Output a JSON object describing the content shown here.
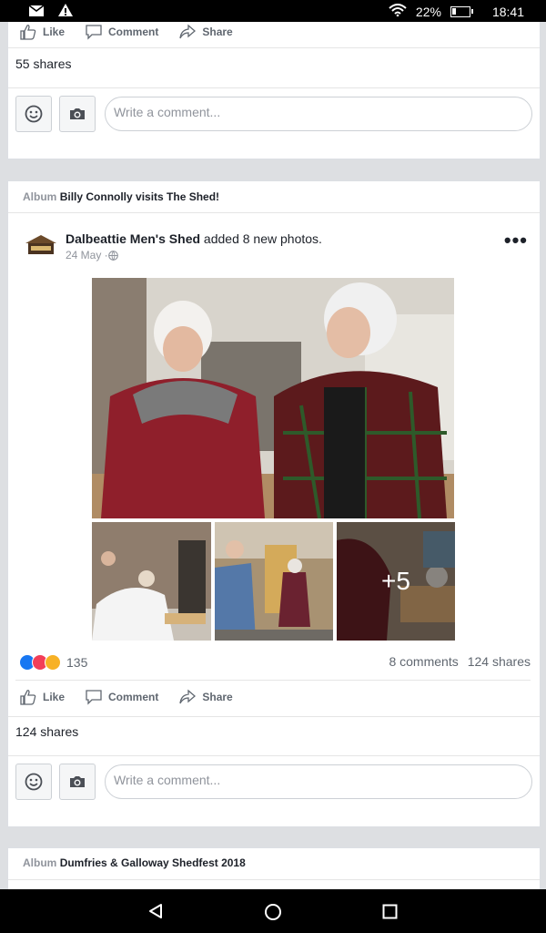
{
  "status_bar": {
    "battery": "22%",
    "time": "18:41",
    "battery_level": 0.22
  },
  "post1": {
    "actions": {
      "like": "Like",
      "comment": "Comment",
      "share": "Share"
    },
    "shares": "55 shares",
    "comment_placeholder": "Write a comment..."
  },
  "post2": {
    "album_label": "Album",
    "album_name": "Billy Connolly visits The Shed!",
    "author": "Dalbeattie Men's Shed",
    "action_text": " added 8 new photos.",
    "date": "24 May · ",
    "more_photos": "+5",
    "reaction_count": "135",
    "comments_count": "8 comments",
    "shares_count": "124 shares",
    "actions": {
      "like": "Like",
      "comment": "Comment",
      "share": "Share"
    },
    "shares": "124 shares",
    "comment_placeholder": "Write a comment..."
  },
  "post3": {
    "album_label": "Album",
    "album_name": "Dumfries & Galloway Shedfest 2018"
  },
  "colors": {
    "reaction_like": "#1877f2",
    "reaction_love": "#f33e58",
    "reaction_haha": "#f7b125"
  }
}
